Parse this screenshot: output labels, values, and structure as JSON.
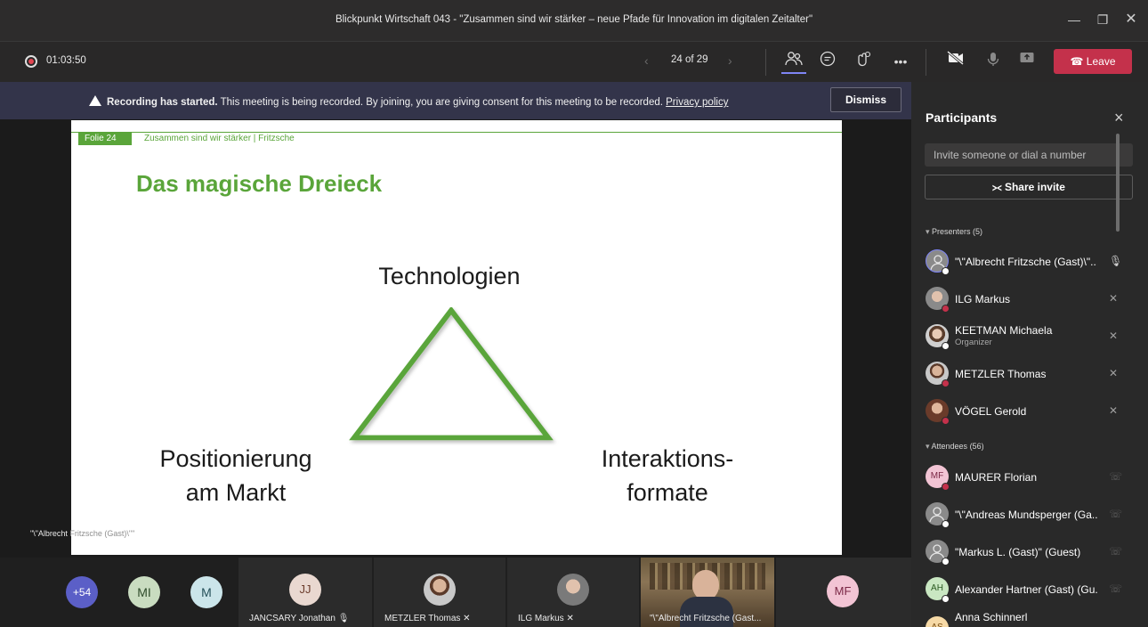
{
  "window": {
    "title": "Blickpunkt Wirtschaft 043 - \"Zusammen sind wir stärker – neue Pfade für Innovation im digitalen Zeitalter\"",
    "minimize_icon": "minimize-icon",
    "maximize_icon": "maximize-icon",
    "close_icon": "close-icon"
  },
  "toolbar": {
    "recording_time": "01:03:50",
    "page_indicator": "24 of 29",
    "leave_label": "Leave",
    "icons": [
      "people-icon",
      "chat-icon",
      "reactions-icon",
      "more-icon",
      "camera-off-icon",
      "mic-icon",
      "share-icon",
      "phone-icon"
    ]
  },
  "banner": {
    "bold": "Recording has started.",
    "text": " This meeting is being recorded. By joining, you are giving consent for this meeting to be recorded. ",
    "link": "Privacy policy",
    "dismiss_label": "Dismiss"
  },
  "slide": {
    "tag": "Folie 24",
    "header": "Zusammen sind wir stärker | Fritzsche",
    "title": "Das magische Dreieck",
    "top_label": "Technologien",
    "left_label_1": "Positionierung",
    "left_label_2": "am Markt",
    "right_label_1": "Interaktions-",
    "right_label_2": "formate",
    "accent_color": "#5aa53a"
  },
  "stage": {
    "presenter_caption_a": "\"\\\"Albrecht",
    "presenter_caption_b": " Fritzsche (Gast)\\\"\""
  },
  "strip": {
    "overflow": "+54",
    "avatar_mi": "MI",
    "avatar_m": "M",
    "jj_initials": "JJ",
    "jj_name": "JANCSARY Jonathan",
    "metzler_name": "METZLER Thomas",
    "ilg_name": "ILG Markus",
    "video_name": "\"\\\"Albrecht Fritzsche (Gast...",
    "mf_initials": "MF"
  },
  "panel": {
    "title": "Participants",
    "invite_placeholder": "Invite someone or dial a number",
    "share_label": "Share invite",
    "presenters_header": "Presenters (5)",
    "attendees_header": "Attendees (56)",
    "presenters": [
      {
        "name": "\"\\\"Albrecht Fritzsche (Gast)\\\"...",
        "sub": ""
      },
      {
        "name": "ILG Markus",
        "sub": ""
      },
      {
        "name": "KEETMAN Michaela",
        "sub": "Organizer"
      },
      {
        "name": "METZLER Thomas",
        "sub": ""
      },
      {
        "name": "VÖGEL Gerold",
        "sub": ""
      }
    ],
    "attendees": [
      {
        "name": "MAURER Florian",
        "initials": "MF"
      },
      {
        "name": "\"\\\"Andreas Mundsperger (Ga...",
        "initials": ""
      },
      {
        "name": "\"Markus L. (Gast)\" (Guest)",
        "initials": ""
      },
      {
        "name": "Alexander Hartner (Gast) (Gu...",
        "initials": "AH"
      },
      {
        "name": "Anna Schinnerl",
        "initials": "AS"
      }
    ]
  }
}
